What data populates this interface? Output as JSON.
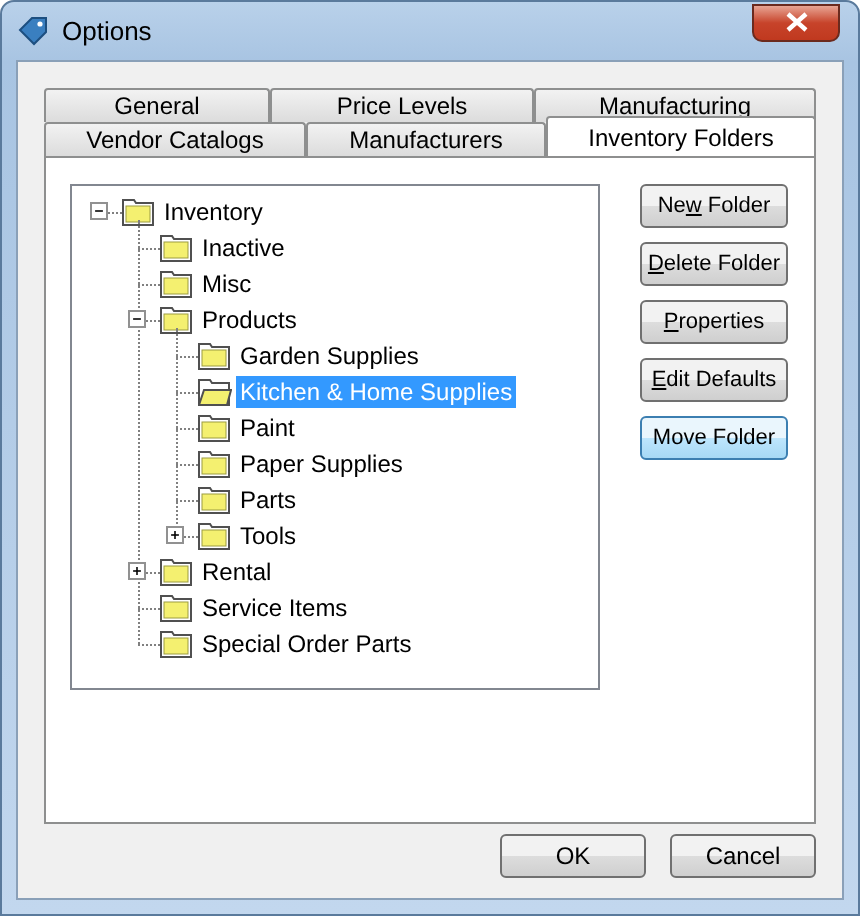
{
  "window": {
    "title": "Options"
  },
  "tab_rows": [
    [
      {
        "label": "General",
        "selected": false
      },
      {
        "label": "Price Levels",
        "selected": false
      },
      {
        "label": "Manufacturing",
        "selected": false
      }
    ],
    [
      {
        "label": "Vendor Catalogs",
        "selected": false
      },
      {
        "label": "Manufacturers",
        "selected": false
      },
      {
        "label": "Inventory Folders",
        "selected": true
      }
    ]
  ],
  "tree": [
    {
      "label": "Inventory",
      "selected": false,
      "expanded": true,
      "children": [
        {
          "label": "Inactive",
          "selected": false
        },
        {
          "label": "Misc",
          "selected": false
        },
        {
          "label": "Products",
          "selected": false,
          "expanded": true,
          "children": [
            {
              "label": "Garden Supplies",
              "selected": false
            },
            {
              "label": "Kitchen & Home Supplies",
              "selected": true
            },
            {
              "label": "Paint",
              "selected": false
            },
            {
              "label": "Paper Supplies",
              "selected": false
            },
            {
              "label": "Parts",
              "selected": false
            },
            {
              "label": "Tools",
              "selected": false,
              "expanded": false
            }
          ]
        },
        {
          "label": "Rental",
          "selected": false,
          "expanded": false
        },
        {
          "label": "Service Items",
          "selected": false
        },
        {
          "label": "Special Order Parts",
          "selected": false
        }
      ]
    }
  ],
  "side_buttons": [
    {
      "parts": [
        {
          "text": "Ne",
          "underlined": false
        },
        {
          "text": "w",
          "underlined": true
        },
        {
          "text": " Folder",
          "underlined": false
        }
      ],
      "focused": false
    },
    {
      "parts": [
        {
          "text": "D",
          "underlined": true
        },
        {
          "text": "elete Folder",
          "underlined": false
        }
      ],
      "focused": false
    },
    {
      "parts": [
        {
          "text": "P",
          "underlined": true
        },
        {
          "text": "roperties",
          "underlined": false
        }
      ],
      "focused": false
    },
    {
      "parts": [
        {
          "text": "E",
          "underlined": true
        },
        {
          "text": "dit Defaults",
          "underlined": false
        }
      ],
      "focused": false
    },
    {
      "parts": [
        {
          "text": "Move Folder",
          "underlined": false
        }
      ],
      "focused": true
    }
  ],
  "buttons": [
    "OK",
    "Cancel"
  ]
}
